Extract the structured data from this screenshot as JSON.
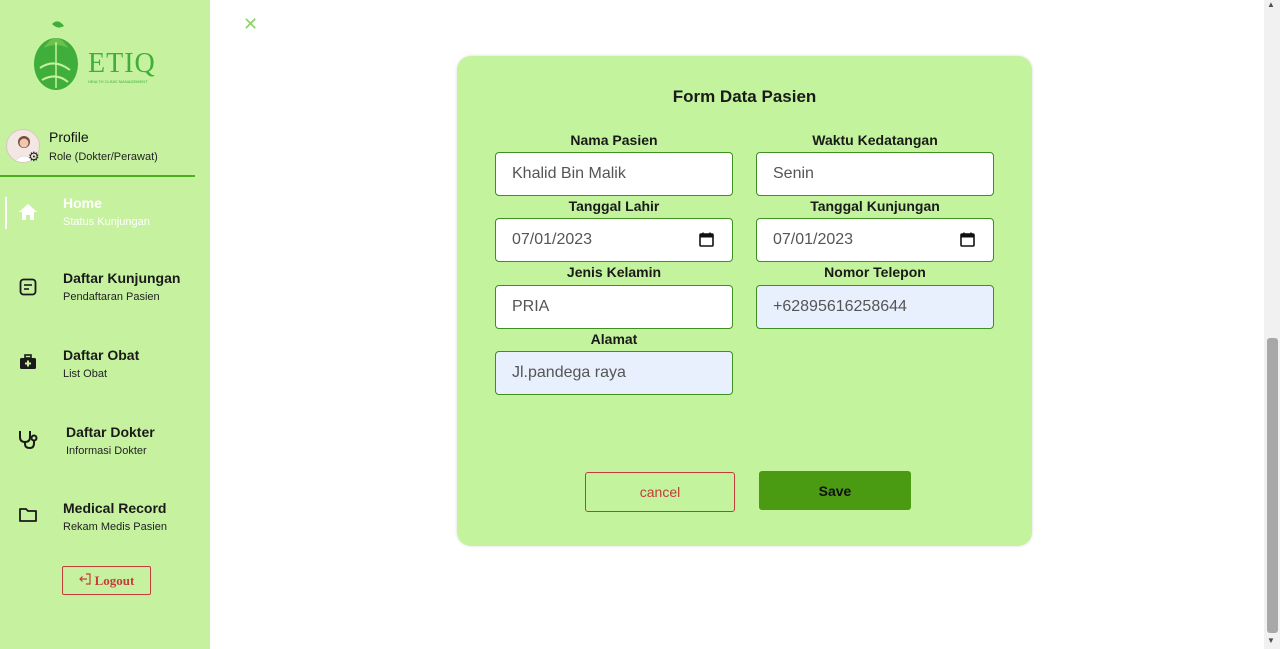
{
  "sidebar": {
    "logo": {
      "text": "ETIQ",
      "tagline": "HEALTH CLINIC MANAGEMENT"
    },
    "profile": {
      "name": "Profile",
      "role": "Role (Dokter/Perawat)"
    },
    "items": [
      {
        "title": "Home",
        "subtitle": "Status Kunjungan",
        "icon": "home-icon",
        "active": true
      },
      {
        "title": "Daftar Kunjungan",
        "subtitle": "Pendaftaran Pasien",
        "icon": "note-icon",
        "active": false
      },
      {
        "title": "Daftar Obat",
        "subtitle": "List Obat",
        "icon": "medkit-icon",
        "active": false
      },
      {
        "title": "Daftar Dokter",
        "subtitle": "Informasi Dokter",
        "icon": "stethoscope-icon",
        "active": false
      },
      {
        "title": "Medical Record",
        "subtitle": "Rekam Medis Pasien",
        "icon": "folder-icon",
        "active": false
      }
    ],
    "logout_label": "Logout"
  },
  "form": {
    "title": "Form Data Pasien",
    "fields": {
      "nama_pasien": {
        "label": "Nama Pasien",
        "value": "Khalid Bin Malik"
      },
      "waktu_kedatangan": {
        "label": "Waktu Kedatangan",
        "value": "Senin"
      },
      "tanggal_lahir": {
        "label": "Tanggal Lahir",
        "value": "07/01/2023"
      },
      "tanggal_kunjungan": {
        "label": "Tanggal Kunjungan",
        "value": "07/01/2023"
      },
      "jenis_kelamin": {
        "label": "Jenis Kelamin",
        "value": "PRIA"
      },
      "nomor_telepon": {
        "label": "Nomor Telepon",
        "value": "+62895616258644"
      },
      "alamat": {
        "label": "Alamat",
        "value": "Jl.pandega raya"
      }
    },
    "cancel_label": "cancel",
    "save_label": "Save"
  },
  "colors": {
    "sidebar_bg": "#c6f2a0",
    "card_bg": "#c3f39d",
    "save_bg": "#4a9a12",
    "cancel_border": "#c43c3c",
    "autofill_bg": "#e8f0fe"
  }
}
